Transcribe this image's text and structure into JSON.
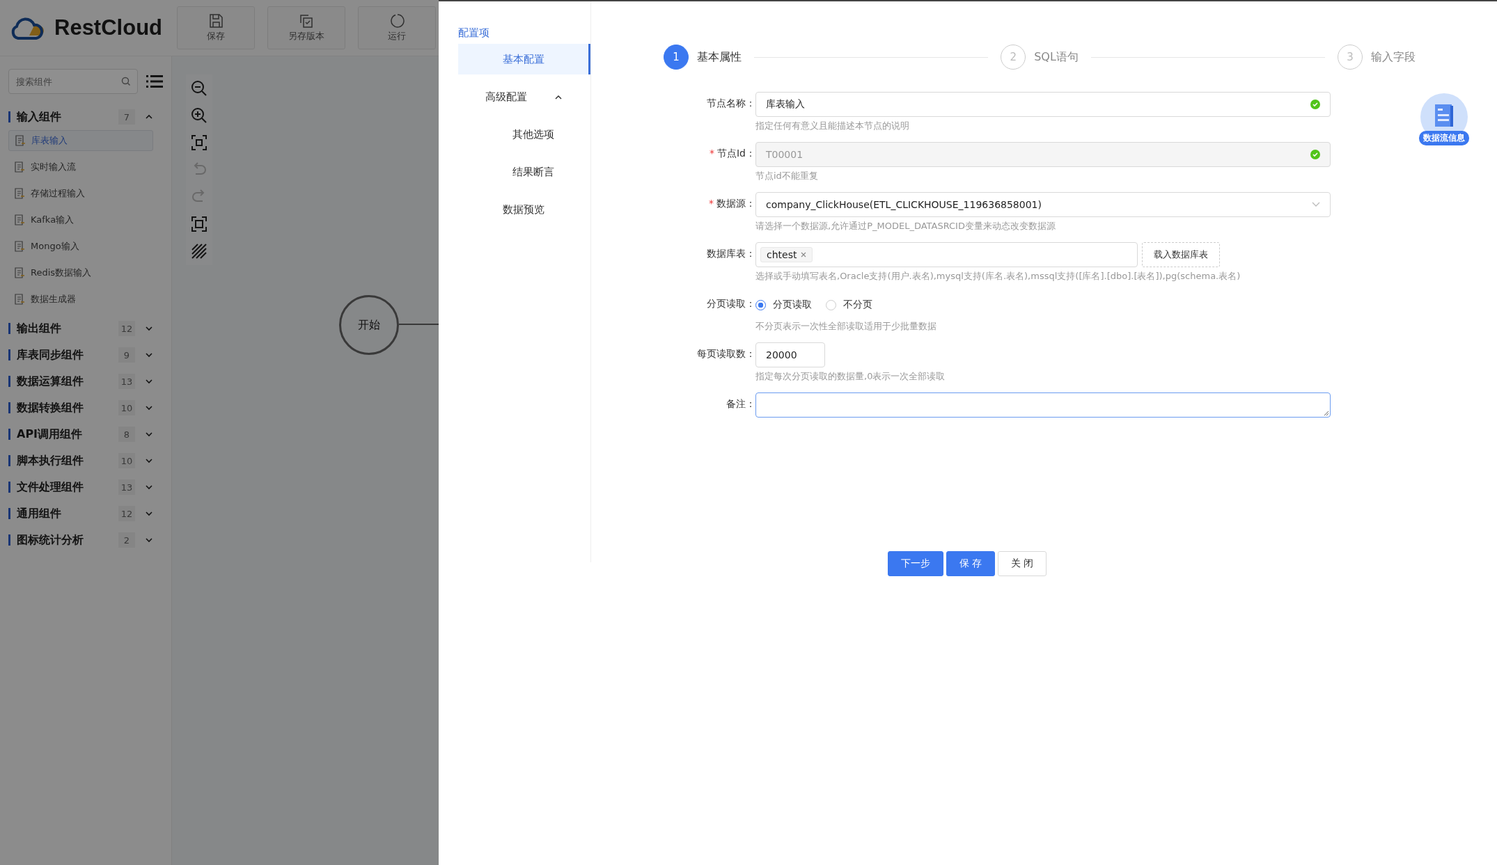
{
  "app": {
    "logo": "RestCloud",
    "toolbar": [
      {
        "kind": "save",
        "label": "保存"
      },
      {
        "kind": "copy",
        "label": "另存版本"
      },
      {
        "kind": "run",
        "label": "运行"
      }
    ]
  },
  "sidebar": {
    "search": {
      "placeholder": "搜索组件"
    },
    "groups": [
      {
        "title": "输入组件",
        "count": "7",
        "expanded": true,
        "items": [
          {
            "label": "库表输入",
            "selected": true
          },
          {
            "label": "实时输入流",
            "selected": false
          },
          {
            "label": "存储过程输入",
            "selected": false
          },
          {
            "label": "Kafka输入",
            "selected": false
          },
          {
            "label": "Mongo输入",
            "selected": false
          },
          {
            "label": "Redis数据输入",
            "selected": false
          },
          {
            "label": "数据生成器",
            "selected": false
          }
        ]
      },
      {
        "title": "输出组件",
        "count": "12",
        "expanded": false
      },
      {
        "title": "库表同步组件",
        "count": "9",
        "expanded": false
      },
      {
        "title": "数据运算组件",
        "count": "13",
        "expanded": false
      },
      {
        "title": "数据转换组件",
        "count": "10",
        "expanded": false
      },
      {
        "title": "API调用组件",
        "count": "8",
        "expanded": false
      },
      {
        "title": "脚本执行组件",
        "count": "10",
        "expanded": false
      },
      {
        "title": "文件处理组件",
        "count": "13",
        "expanded": false
      },
      {
        "title": "通用组件",
        "count": "12",
        "expanded": false
      },
      {
        "title": "图标统计分析",
        "count": "2",
        "expanded": false
      }
    ]
  },
  "canvas": {
    "tools": [
      {
        "kind": "zoom-out",
        "disabled": false
      },
      {
        "kind": "zoom-in",
        "disabled": false
      },
      {
        "kind": "fit",
        "disabled": false
      },
      {
        "kind": "undo",
        "disabled": true
      },
      {
        "kind": "redo",
        "disabled": true
      },
      {
        "kind": "fullscreen",
        "disabled": false
      },
      {
        "kind": "grid",
        "disabled": false
      }
    ],
    "start_node": "开始"
  },
  "drawer": {
    "nav_title": "配置项",
    "nav": [
      {
        "label": "基本配置",
        "selected": true
      },
      {
        "label": "高级配置",
        "selected": false,
        "expanded": true,
        "children": [
          {
            "label": "其他选项",
            "selected": false
          },
          {
            "label": "结果断言",
            "selected": false
          }
        ]
      },
      {
        "label": "数据预览",
        "selected": false
      }
    ],
    "steps": [
      {
        "number": "1",
        "label": "基本属性",
        "selected": true
      },
      {
        "number": "2",
        "label": "SQL语句",
        "selected": false
      },
      {
        "number": "3",
        "label": "输入字段",
        "selected": false
      }
    ],
    "fields": [
      {
        "kind": "input",
        "label": "节点名称：",
        "value": "库表输入",
        "disabled": false,
        "valid": true,
        "help": "指定任何有意义且能描述本节点的说明"
      },
      {
        "kind": "input",
        "label": "节点Id：",
        "required_mark": "*",
        "value": "T00001",
        "disabled": true,
        "valid": true,
        "help": "节点id不能重复"
      },
      {
        "kind": "select",
        "label": "数据源：",
        "required_mark": "*",
        "value": "company_ClickHouse(ETL_CLICKHOUSE_119636858001)",
        "help": "请选择一个数据源,允许通过P_MODEL_DATASRCID变量来动态改变数据源"
      },
      {
        "kind": "tags",
        "label": "数据库表：",
        "tags": [
          "chtest"
        ],
        "button": "载入数据库表",
        "help": "选择或手动填写表名,Oracle支持(用户.表名),mysql支持(库名.表名),mssql支持([库名].[dbo].[表名]),pg(schema.表名)"
      },
      {
        "kind": "radio",
        "label": "分页读取：",
        "options": [
          {
            "label": "分页读取",
            "selected": true
          },
          {
            "label": "不分页",
            "selected": false
          }
        ],
        "help": "不分页表示一次性全部读取适用于少批量数据"
      },
      {
        "kind": "number",
        "label": "每页读取数：",
        "value": "20000",
        "help": "指定每次分页读取的数据量,0表示一次全部读取"
      },
      {
        "kind": "textarea",
        "label": "备注：",
        "focused": true
      }
    ],
    "buttons": [
      {
        "label": "下一步",
        "primary": true
      },
      {
        "label": "保 存",
        "primary": true
      },
      {
        "label": "关 闭",
        "primary": false
      }
    ],
    "badge": "数据流信息"
  }
}
